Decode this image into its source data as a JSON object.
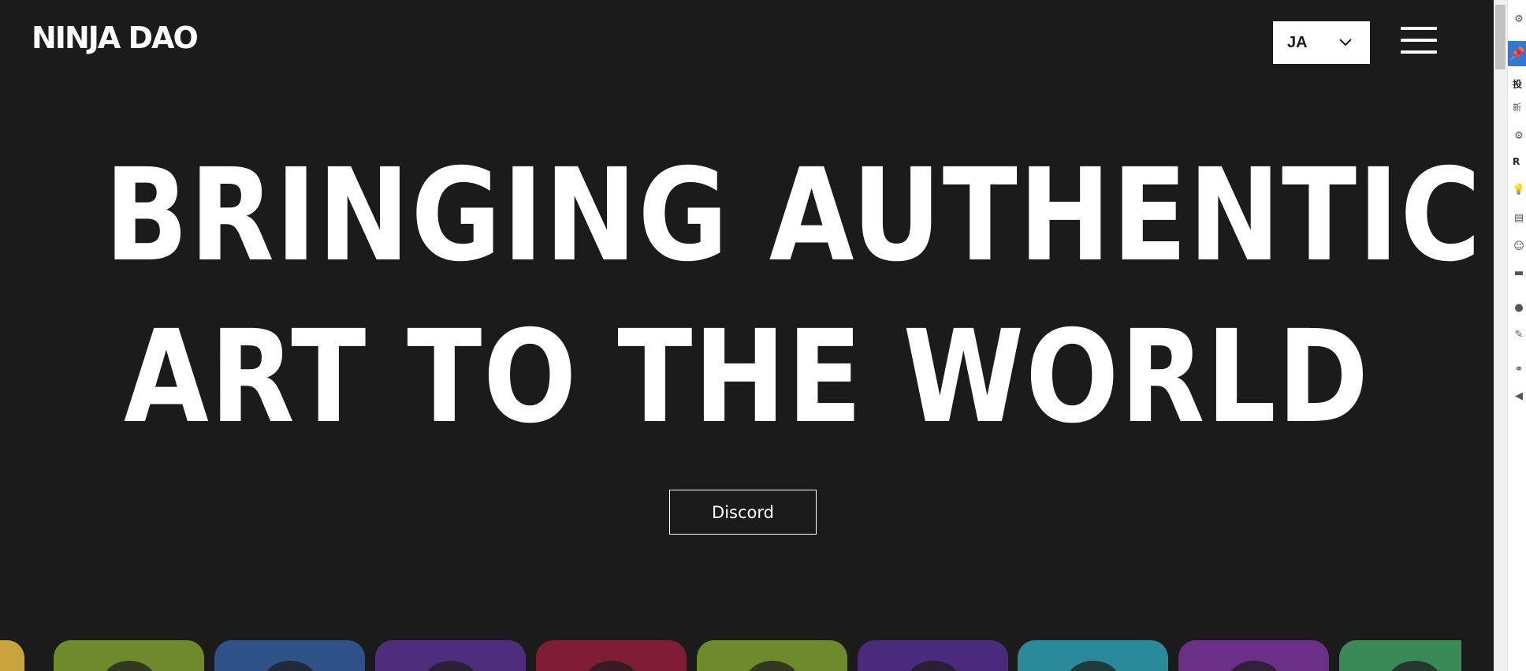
{
  "header": {
    "logo_text": "NINJA DAO",
    "language": {
      "selected": "JA"
    }
  },
  "hero": {
    "title_lines": [
      "BRINGING AUTHENTIC JAPANESE",
      "ART TO THE WORLD"
    ],
    "cta_label": "Discord"
  },
  "carousel": {
    "cards": [
      {
        "name": "card-1",
        "color": "#c9a43a"
      },
      {
        "name": "card-2",
        "color": "#6f8a2a"
      },
      {
        "name": "card-3",
        "color": "#2f5289"
      },
      {
        "name": "card-4",
        "color": "#4e2d7c"
      },
      {
        "name": "card-5",
        "color": "#7f1d37"
      },
      {
        "name": "card-6",
        "color": "#6f8a2a"
      },
      {
        "name": "card-7",
        "color": "#4a2a7d"
      },
      {
        "name": "card-8",
        "color": "#2a8a9a"
      },
      {
        "name": "card-9",
        "color": "#6a2f86"
      },
      {
        "name": "card-10",
        "color": "#3a8a55"
      }
    ]
  },
  "side_panel": {
    "label_1": "投",
    "label_2": "新",
    "label_3": "R"
  },
  "colors": {
    "background": "#1b1b1b",
    "text": "#ffffff",
    "side_panel_accent": "#2f78d6"
  }
}
